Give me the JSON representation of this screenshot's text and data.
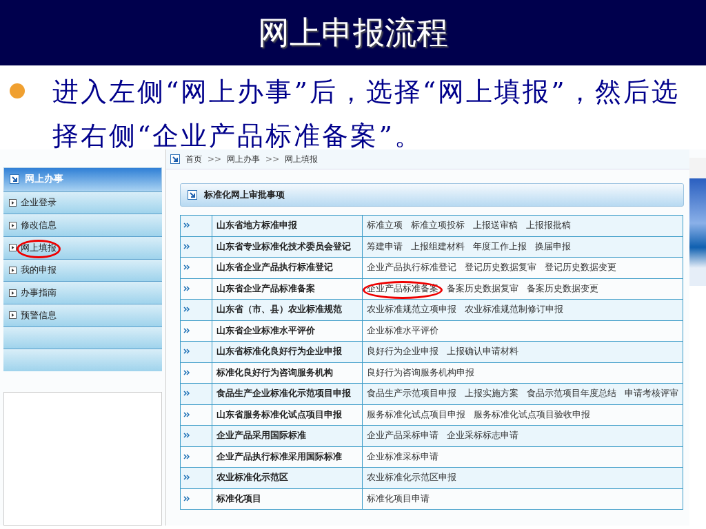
{
  "slide": {
    "title": "网上申报流程",
    "bullet": "进入左侧“网上办事”后，选择“网上填报”，然后选择右侧“企业产品标准备案”。"
  },
  "sidebar": {
    "heading": "网上办事",
    "items": [
      {
        "label": "企业登录",
        "circled": false
      },
      {
        "label": "修改信息",
        "circled": false
      },
      {
        "label": "网上填报",
        "circled": true
      },
      {
        "label": "我的申报",
        "circled": false
      },
      {
        "label": "办事指南",
        "circled": false
      },
      {
        "label": "预警信息",
        "circled": false
      }
    ]
  },
  "breadcrumb": [
    "首页",
    ">>",
    "网上办事",
    ">>",
    "网上填报"
  ],
  "section": {
    "title": "标准化网上审批事项"
  },
  "table": {
    "rows": [
      {
        "name": "山东省地方标准申报",
        "links": [
          {
            "label": "标准立项",
            "circled": false
          },
          {
            "label": "标准立项投标",
            "circled": false
          },
          {
            "label": "上报送审稿",
            "circled": false
          },
          {
            "label": "上报报批稿",
            "circled": false
          }
        ]
      },
      {
        "name": "山东省专业标准化技术委员会登记",
        "links": [
          {
            "label": "筹建申请",
            "circled": false
          },
          {
            "label": "上报组建材料",
            "circled": false
          },
          {
            "label": "年度工作上报",
            "circled": false
          },
          {
            "label": "换届申报",
            "circled": false
          }
        ]
      },
      {
        "name": "山东省企业产品执行标准登记",
        "links": [
          {
            "label": "企业产品执行标准登记",
            "circled": false
          },
          {
            "label": "登记历史数据复审",
            "circled": false
          },
          {
            "label": "登记历史数据变更",
            "circled": false
          }
        ]
      },
      {
        "name": "山东省企业产品标准备案",
        "links": [
          {
            "label": "企业产品标准备案",
            "circled": true
          },
          {
            "label": "备案历史数据复审",
            "circled": false
          },
          {
            "label": "备案历史数据变更",
            "circled": false
          }
        ]
      },
      {
        "name": "山东省（市、县）农业标准规范",
        "links": [
          {
            "label": "农业标准规范立项申报",
            "circled": false
          },
          {
            "label": "农业标准规范制修订申报",
            "circled": false
          }
        ]
      },
      {
        "name": "山东省企业标准水平评价",
        "links": [
          {
            "label": "企业标准水平评价",
            "circled": false
          }
        ]
      },
      {
        "name": "山东省标准化良好行为企业申报",
        "links": [
          {
            "label": "良好行为企业申报",
            "circled": false
          },
          {
            "label": "上报确认申请材料",
            "circled": false
          }
        ]
      },
      {
        "name": "标准化良好行为咨询服务机构",
        "links": [
          {
            "label": "良好行为咨询服务机构申报",
            "circled": false
          }
        ]
      },
      {
        "name": "食品生产企业标准化示范项目申报",
        "links": [
          {
            "label": "食品生产示范项目申报",
            "circled": false
          },
          {
            "label": "上报实施方案",
            "circled": false
          },
          {
            "label": "食品示范项目年度总结",
            "circled": false
          },
          {
            "label": "申请考核评审",
            "circled": false
          }
        ]
      },
      {
        "name": "山东省服务标准化试点项目申报",
        "links": [
          {
            "label": "服务标准化试点项目申报",
            "circled": false
          },
          {
            "label": "服务标准化试点项目验收申报",
            "circled": false
          }
        ]
      },
      {
        "name": "企业产品采用国际标准",
        "links": [
          {
            "label": "企业产品采标申请",
            "circled": false
          },
          {
            "label": "企业采标标志申请",
            "circled": false
          }
        ]
      },
      {
        "name": "企业产品执行标准采用国际标准",
        "links": [
          {
            "label": "企业标准采标申请",
            "circled": false
          }
        ]
      },
      {
        "name": "农业标准化示范区",
        "links": [
          {
            "label": "农业标准化示范区申报",
            "circled": false
          }
        ]
      },
      {
        "name": "标准化项目",
        "links": [
          {
            "label": "标准化项目申请",
            "circled": false
          }
        ]
      }
    ]
  }
}
